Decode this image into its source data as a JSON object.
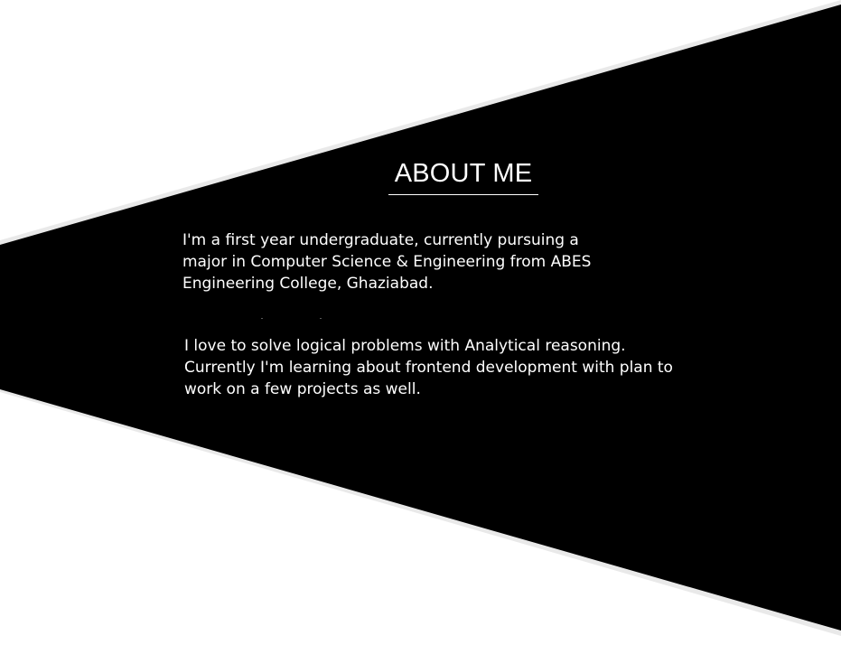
{
  "about": {
    "title": "ABOUT ME",
    "paragraph_1": {
      "lines": [
        "I'm a first year undergraduate, currently pursuing a",
        "major in Computer Science & Engineering from ABES",
        "Engineering College, Ghaziabad."
      ]
    },
    "paragraph_2": {
      "lines": [
        "I love to solve logical problems with Analytical reasoning.",
        "Currently I'm learning about frontend development with plan to",
        "work on a few projects as well."
      ]
    }
  },
  "colors": {
    "background": "#ffffff",
    "panel": "#000000",
    "panel_edge": "#e6e6e6",
    "text": "#ffffff"
  }
}
